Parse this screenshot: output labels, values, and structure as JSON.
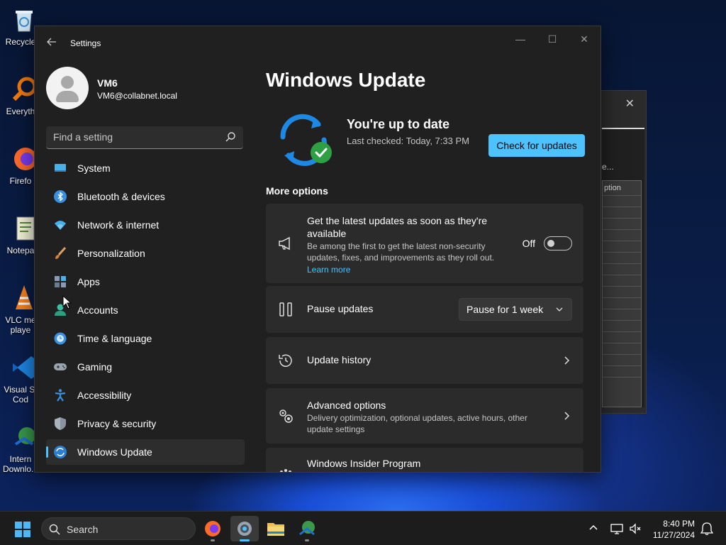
{
  "desktop": {
    "icons": [
      {
        "label": "Recycle",
        "icon": "recycle-bin-icon"
      },
      {
        "label": "Everyth",
        "icon": "everything-search-icon"
      },
      {
        "label": "Firefo",
        "icon": "firefox-icon"
      },
      {
        "label": "Notepa",
        "icon": "notepad-icon"
      },
      {
        "label": "VLC me",
        "label2": "playe",
        "icon": "vlc-icon"
      },
      {
        "label": "Visual St",
        "label2": "Cod",
        "icon": "vscode-icon"
      },
      {
        "label": "Intern",
        "label2": "Downlo...",
        "icon": "internet-download-icon"
      }
    ],
    "background_window": {
      "label": "e...",
      "column_header": "ption"
    }
  },
  "window": {
    "app_title": "Settings",
    "controls": {
      "minimize": "—",
      "maximize": "☐",
      "close": "✕"
    }
  },
  "profile": {
    "name": "VM6",
    "email": "VM6@collabnet.local"
  },
  "search": {
    "placeholder": "Find a setting"
  },
  "nav": {
    "items": [
      {
        "label": "System",
        "icon": "system-icon"
      },
      {
        "label": "Bluetooth & devices",
        "icon": "bluetooth-icon"
      },
      {
        "label": "Network & internet",
        "icon": "network-icon"
      },
      {
        "label": "Personalization",
        "icon": "brush-icon"
      },
      {
        "label": "Apps",
        "icon": "apps-icon"
      },
      {
        "label": "Accounts",
        "icon": "accounts-icon"
      },
      {
        "label": "Time & language",
        "icon": "time-language-icon"
      },
      {
        "label": "Gaming",
        "icon": "gamepad-icon"
      },
      {
        "label": "Accessibility",
        "icon": "accessibility-icon"
      },
      {
        "label": "Privacy & security",
        "icon": "shield-icon"
      },
      {
        "label": "Windows Update",
        "icon": "windows-update-icon",
        "active": true
      }
    ]
  },
  "main": {
    "title": "Windows Update",
    "status": {
      "title": "You're up to date",
      "subtitle": "Last checked: Today, 7:33 PM"
    },
    "check_button": "Check for updates",
    "section_label": "More options",
    "cards": {
      "latest": {
        "title": "Get the latest updates as soon as they're",
        "title2": "available",
        "desc": "Be among the first to get the latest non-security",
        "desc2": "updates, fixes, and improvements as they roll out.",
        "link": "Learn more",
        "toggle_label": "Off",
        "toggle_on": false
      },
      "pause": {
        "title": "Pause updates",
        "dropdown": "Pause for 1 week"
      },
      "history": {
        "title": "Update history"
      },
      "advanced": {
        "title": "Advanced options",
        "desc": "Delivery optimization, optional updates, active hours, other",
        "desc2": "update settings"
      },
      "insider": {
        "title": "Windows Insider Program"
      }
    }
  },
  "taskbar": {
    "search_label": "Search",
    "apps": [
      "firefox-icon",
      "settings-gear-icon",
      "file-explorer-icon",
      "internet-download-icon"
    ],
    "clock": {
      "time": "8:40 PM",
      "date": "11/27/2024"
    }
  },
  "colors": {
    "accent": "#4cc2ff",
    "window_bg": "#202020",
    "card_bg": "#2b2b2b",
    "update_blue": "#1e88e5",
    "update_green": "#2ea043"
  }
}
